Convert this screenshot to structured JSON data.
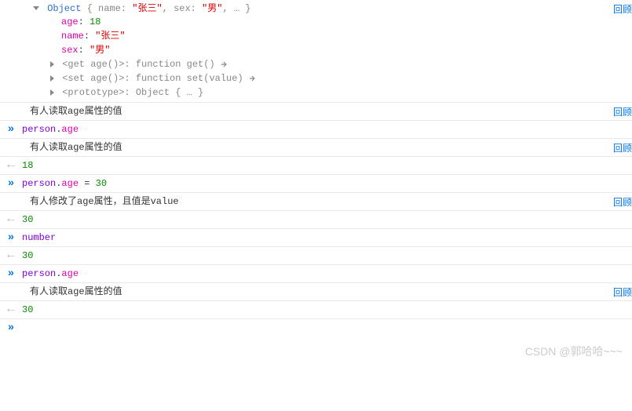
{
  "object_header": {
    "type_label": "Object",
    "inline_preview": "{ name: \"张三\", sex: \"男\", … }",
    "name_key": "name",
    "name_val": "\"张三\"",
    "sex_key": "sex",
    "sex_val": "\"男\"",
    "ellipsis": "…"
  },
  "object_props": {
    "age_key": "age",
    "age_val": "18",
    "name_key": "name",
    "name_val": "\"张三\"",
    "sex_key": "sex",
    "sex_val": "\"男\"",
    "getter": "<get age()>",
    "getter_val": "function get()",
    "setter": "<set age()>",
    "setter_val": "function set(value)",
    "proto_key": "<prototype>",
    "proto_val": "Object { … }"
  },
  "review_label": "回顾",
  "rows": {
    "log1": "有人读取age属性的值",
    "input1_obj": "person",
    "input1_prop": "age",
    "log2": "有人读取age属性的值",
    "output1": "18",
    "input2_obj": "person",
    "input2_prop": "age",
    "input2_assign": " = ",
    "input2_val": "30",
    "log3": "有人修改了age属性，且值是value",
    "output2": "30",
    "input3": "number",
    "output3": "30",
    "input4_obj": "person",
    "input4_prop": "age",
    "log4": "有人读取age属性的值",
    "output4": "30"
  },
  "watermark": "CSDN @郭哈哈~~~"
}
